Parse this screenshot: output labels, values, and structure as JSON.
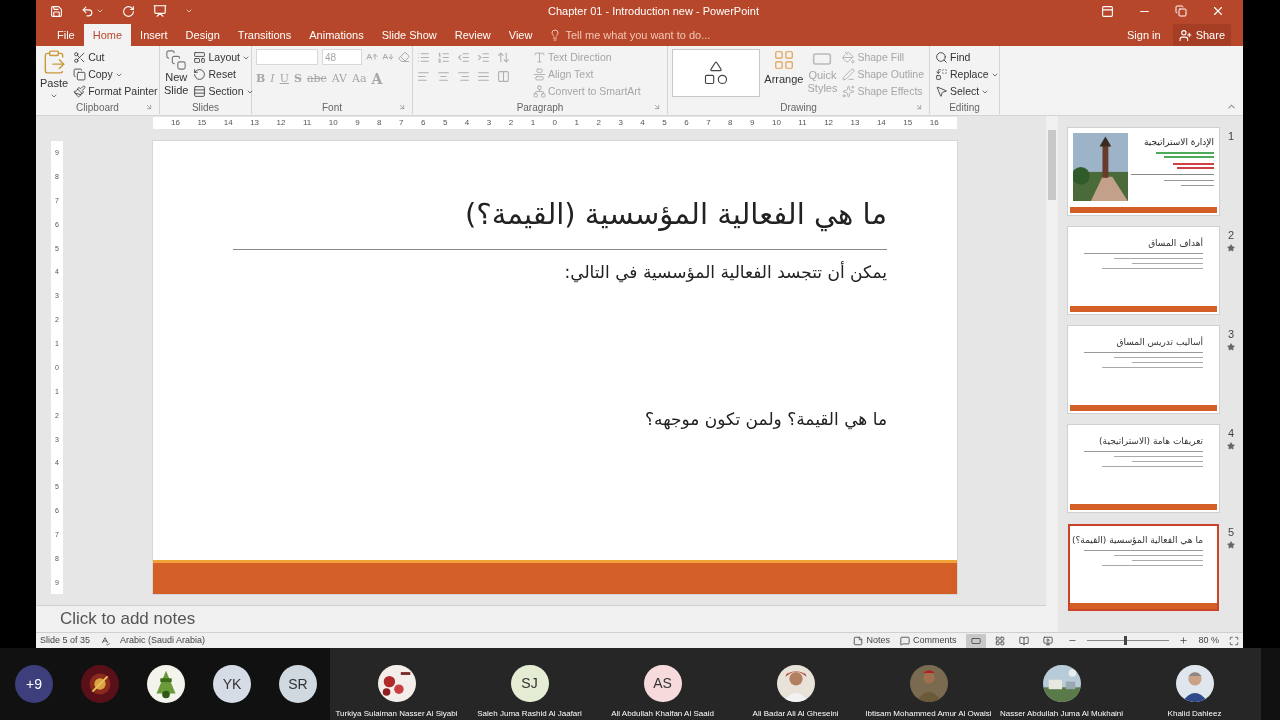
{
  "window": {
    "title": "Chapter 01 - Introduction new - PowerPoint"
  },
  "tabs": [
    {
      "label": "File",
      "selected": false
    },
    {
      "label": "Home",
      "selected": true
    },
    {
      "label": "Insert",
      "selected": false
    },
    {
      "label": "Design",
      "selected": false
    },
    {
      "label": "Transitions",
      "selected": false
    },
    {
      "label": "Animations",
      "selected": false
    },
    {
      "label": "Slide Show",
      "selected": false
    },
    {
      "label": "Review",
      "selected": false
    },
    {
      "label": "View",
      "selected": false
    }
  ],
  "tell_me": {
    "placeholder": "Tell me what you want to do..."
  },
  "account": {
    "sign_in": "Sign in",
    "share": "Share"
  },
  "ribbon": {
    "clipboard": {
      "label": "Clipboard",
      "paste": {
        "label": "Paste",
        "disabled": false
      },
      "items": [
        {
          "label": "Cut",
          "disabled": false
        },
        {
          "label": "Copy",
          "disabled": false
        },
        {
          "label": "Format Painter",
          "disabled": false
        }
      ]
    },
    "slides": {
      "label": "Slides",
      "new_slide": {
        "label": "New Slide",
        "disabled": false
      },
      "items": [
        {
          "label": "Layout",
          "disabled": false
        },
        {
          "label": "Reset",
          "disabled": false
        },
        {
          "label": "Section",
          "disabled": false
        }
      ]
    },
    "font": {
      "label": "Font",
      "size": "48",
      "disabled": true,
      "format_buttons": [
        "B",
        "I",
        "U",
        "S",
        "abc",
        "AV",
        "Aa",
        "A"
      ]
    },
    "paragraph": {
      "label": "Paragraph",
      "items": [
        {
          "label": "Text Direction",
          "disabled": true
        },
        {
          "label": "Align Text",
          "disabled": true
        },
        {
          "label": "Convert to SmartArt",
          "disabled": true
        }
      ]
    },
    "drawing": {
      "label": "Drawing",
      "arrange": {
        "label": "Arrange",
        "disabled": false
      },
      "quick_styles": {
        "label": "Quick Styles",
        "disabled": true
      },
      "items": [
        {
          "label": "Shape Fill",
          "disabled": true
        },
        {
          "label": "Shape Outline",
          "disabled": true
        },
        {
          "label": "Shape Effects",
          "disabled": true
        }
      ]
    },
    "editing": {
      "label": "Editing",
      "items": [
        {
          "label": "Find",
          "disabled": false
        },
        {
          "label": "Replace",
          "disabled": false
        },
        {
          "label": "Select",
          "disabled": false
        }
      ]
    }
  },
  "ruler": {
    "horizontal": [
      "16",
      "15",
      "14",
      "13",
      "12",
      "11",
      "10",
      "9",
      "8",
      "7",
      "6",
      "5",
      "4",
      "3",
      "2",
      "1",
      "0",
      "1",
      "2",
      "3",
      "4",
      "5",
      "6",
      "7",
      "8",
      "9",
      "10",
      "11",
      "12",
      "13",
      "14",
      "15",
      "16"
    ],
    "vertical": [
      "9",
      "8",
      "7",
      "6",
      "5",
      "4",
      "3",
      "2",
      "1",
      "0",
      "1",
      "2",
      "3",
      "4",
      "5",
      "6",
      "7",
      "8",
      "9"
    ]
  },
  "slide": {
    "title": "ما هي الفعالية المؤسسية (القيمة؟)",
    "body": [
      "يمكن أن تتجسد الفعالية المؤسسية في التالي:",
      "ما هي القيمة؟ ولمن تكون موجهه؟"
    ]
  },
  "notes": {
    "placeholder": "Click to add notes"
  },
  "thumbnails": [
    {
      "number": "1",
      "title": "الإدارة الاستراتيجية",
      "kind": "title",
      "animated": false,
      "selected": false
    },
    {
      "number": "2",
      "title": "أهداف المساق",
      "kind": "content",
      "animated": true,
      "selected": false
    },
    {
      "number": "3",
      "title": "أساليب تدريس المساق",
      "kind": "content",
      "animated": true,
      "selected": false
    },
    {
      "number": "4",
      "title": "تعريفات هامة (الاستراتيجية)",
      "kind": "content",
      "animated": true,
      "selected": false
    },
    {
      "number": "5",
      "title": "ما هي الفعالية المؤسسية (القيمة؟)",
      "kind": "content",
      "animated": true,
      "selected": true
    }
  ],
  "status_bar": {
    "slide": "Slide 5 of 35",
    "language": "Arabic (Saudi Arabia)",
    "notes": "Notes",
    "comments": "Comments",
    "views": [
      {
        "selected": true
      },
      {
        "selected": false
      },
      {
        "selected": false
      },
      {
        "selected": false
      }
    ],
    "zoom": {
      "level": 0.45,
      "reading": "80 %"
    }
  },
  "participants": [
    {
      "kind": "count",
      "text": "+9",
      "color": "#3d3f7c"
    },
    {
      "kind": "picture"
    },
    {
      "kind": "picture"
    },
    {
      "kind": "initials",
      "text": "YK",
      "color": "#d6dce6"
    },
    {
      "kind": "initials",
      "text": "SR",
      "color": "#cfd9df"
    },
    {
      "kind": "picture",
      "name": "Turkiya Sulaiman Nasser Al Siyabi"
    },
    {
      "kind": "initials",
      "text": "SJ",
      "color": "#e4edd3",
      "name": "Saleh Juma Rashid Al Jaafari"
    },
    {
      "kind": "initials",
      "text": "AS",
      "color": "#f6dadc",
      "name": "Ali Abdullah Khalfan Al Saaid"
    },
    {
      "kind": "picture",
      "name": "Ali Badar Ali Al Gheseini"
    },
    {
      "kind": "picture",
      "name": "Ibtisam Mohammed Amur Al Owaisi"
    },
    {
      "kind": "picture",
      "name": "Nasser Abdullah Juma Al Mukhaini"
    },
    {
      "kind": "picture",
      "name": "Khalid Dahleez"
    }
  ]
}
